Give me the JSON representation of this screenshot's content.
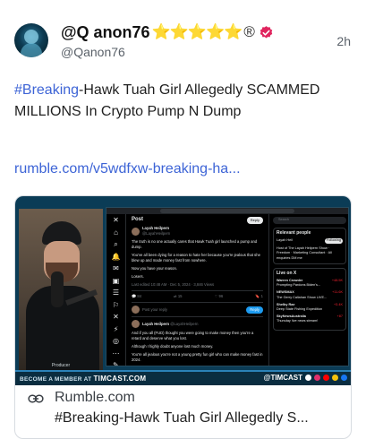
{
  "post": {
    "author": {
      "display_name": "@Q anon76",
      "badges": "⭐⭐⭐⭐⭐",
      "registered_mark": "®",
      "handle": "@Qanon76",
      "verified_color": "#e0245e"
    },
    "time": "2h",
    "text": {
      "hashtag": "#Breaking",
      "body": "-Hawk Tuah Girl Allegedly SCAMMED MILLIONS In Crypto Pump N Dump"
    },
    "link_text": "rumble.com/v5wdfxw-breaking-ha...",
    "link_color": "#3d64d6"
  },
  "card": {
    "thumbnail": {
      "camera_label": "Producer",
      "x_nav_icons": [
        "✕",
        "⌂",
        "⌕",
        "🔔",
        "✉",
        "▣",
        "☰",
        "⚐",
        "✕",
        "⚡",
        "◎",
        "⋯",
        "✎"
      ],
      "post_header": "Post",
      "reply_button": "Reply",
      "author_name": "Layah Heilpern",
      "author_handle": "@LayahHeilpern",
      "paragraphs": [
        "The truth is no one actually cares that Hawk Tuah girl launched a pump and dump.",
        "You've all been dying for a reason to hate her because you're jealous that she blew up and made money fast from nowhere.",
        "Now you have your reason.",
        "Losers."
      ],
      "meta": "Last edited 10:48 AM · Dec 5, 2024 · 3,846 Views",
      "actions": [
        "💬 84",
        "⇄ 15",
        "♡ 96",
        "🔖 1"
      ],
      "reply_placeholder": "Post your reply",
      "reply_action": "Reply",
      "reply_author": "Layah Heilpern",
      "reply_handle": "@LayahHeilpern",
      "reply_text": [
        "And if you all (FUD) thought you were going to make money then you're a retard and deserve what you lost.",
        "Although I highly doubt anyone lost much money.",
        "You're all jealous you're not a young pretty fun girl who can make money fast in 2024."
      ],
      "search_placeholder": "Search",
      "relevant_header": "Relevant people",
      "relevant_name": "Layah Heil",
      "relevant_bio": "Host of The Layah Heilpern Show · Freedom · Marketing Consultant · All enquiries DM me",
      "follow_label": "Following",
      "live_header": "Live on X",
      "live_items": [
        {
          "host": "Warren Crowder",
          "title": "Prompting Pardons Biden's...",
          "count": "+48.5K"
        },
        {
          "host": "NEWSMAX",
          "title": "The Gerry Callahan Show LIVE...",
          "count": "+11.6K"
        },
        {
          "host": "Shelby Rae",
          "title": "Deep State Fishing Expedition",
          "count": "+3.4K"
        },
        {
          "host": "SkyNewsAustralia",
          "title": "Thursday live news stream!",
          "count": "+87"
        }
      ],
      "banner_left_prefix": "BECOME A MEMBER AT",
      "banner_left_site": "TIMCAST.COM",
      "banner_right": "@TIMCAST",
      "social_colors": [
        "#ffffff",
        "#e1306c",
        "#ff0000",
        "#f4c20d",
        "#1877f2"
      ]
    },
    "domain": "Rumble.com",
    "title": "#Breaking-Hawk Tuah Girl Allegedly S..."
  }
}
